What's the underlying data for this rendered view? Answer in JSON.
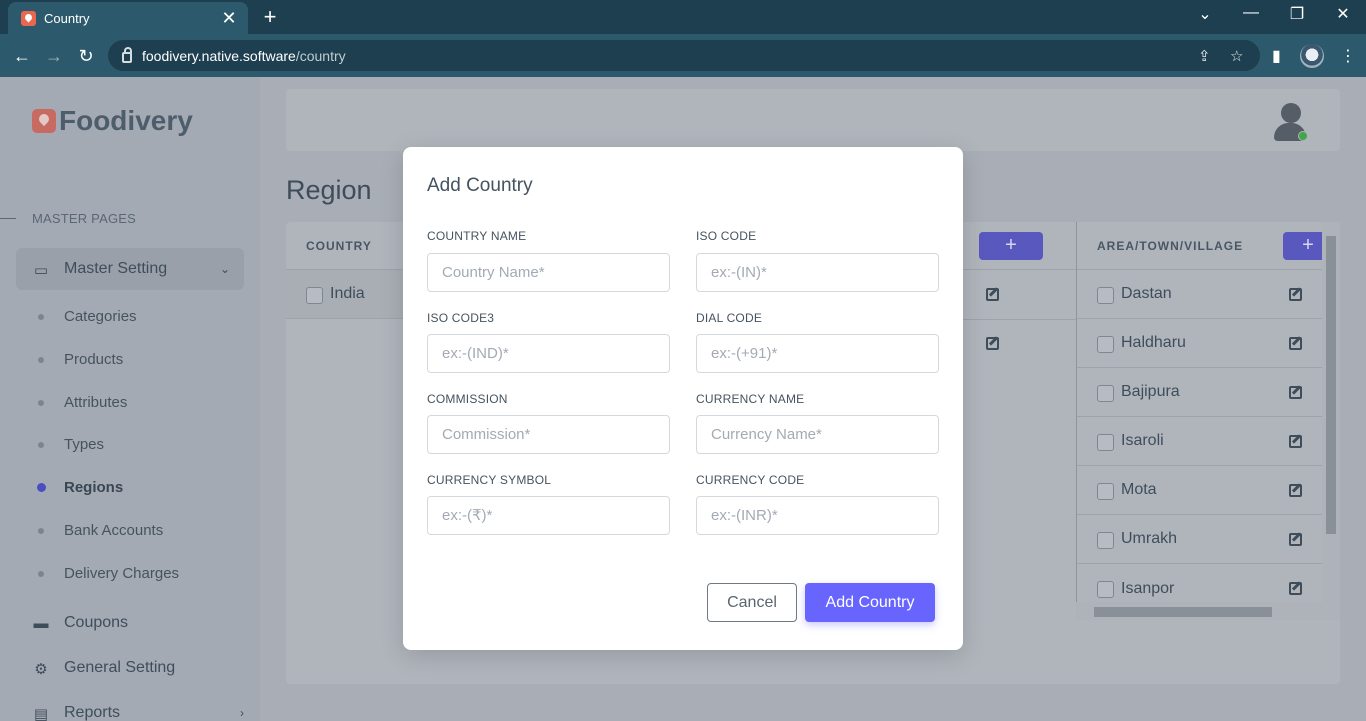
{
  "browser": {
    "tab_title": "Country",
    "tab_close": "✕",
    "new_tab": "+",
    "url_host": "foodivery.native.software",
    "url_path": "/country",
    "window_controls": {
      "dropdown": "⌄",
      "minimize": "—",
      "restore": "❐",
      "close": "✕"
    },
    "nav": {
      "back": "←",
      "forward": "→",
      "reload": "↻"
    },
    "icons": {
      "share": "⇪",
      "bookmark": "☆",
      "sidebar": "▮",
      "menu": "⋮"
    }
  },
  "sidebar": {
    "logo": "Foodivery",
    "section_label": "MASTER PAGES",
    "master_setting": {
      "label": "Master Setting",
      "icon": "▭",
      "chevron": "⌄"
    },
    "sub_items": [
      {
        "label": "Categories"
      },
      {
        "label": "Products"
      },
      {
        "label": "Attributes"
      },
      {
        "label": "Types"
      },
      {
        "label": "Regions"
      },
      {
        "label": "Bank Accounts"
      },
      {
        "label": "Delivery Charges"
      }
    ],
    "menu_items": [
      {
        "label": "Coupons",
        "icon": "▬"
      },
      {
        "label": "General Setting",
        "icon": "⚙"
      },
      {
        "label": "Reports",
        "icon": "▤",
        "chevron": "›"
      }
    ]
  },
  "main": {
    "page_title": "Region",
    "country_col": {
      "header": "COUNTRY",
      "rows": [
        "India"
      ]
    },
    "add_button": "+",
    "area_col": {
      "header": "AREA/TOWN/VILLAGE",
      "rows": [
        "Dastan",
        "Haldharu",
        "Bajipura",
        "Isaroli",
        "Mota",
        "Umrakh",
        "Isanpor"
      ]
    }
  },
  "modal": {
    "title": "Add Country",
    "fields": {
      "country_name": {
        "label": "COUNTRY NAME",
        "placeholder": "Country Name*"
      },
      "iso_code": {
        "label": "ISO CODE",
        "placeholder": "ex:-(IN)*"
      },
      "iso_code3": {
        "label": "ISO CODE3",
        "placeholder": "ex:-(IND)*"
      },
      "dial_code": {
        "label": "DIAL CODE",
        "placeholder": "ex:-(+91)*"
      },
      "commission": {
        "label": "COMMISSION",
        "placeholder": "Commission*"
      },
      "currency_name": {
        "label": "CURRENCY NAME",
        "placeholder": "Currency Name*"
      },
      "currency_symbol": {
        "label": "CURRENCY SYMBOL",
        "placeholder": "ex:-(₹)*"
      },
      "currency_code": {
        "label": "CURRENCY CODE",
        "placeholder": "ex:-(INR)*"
      }
    },
    "cancel_label": "Cancel",
    "submit_label": "Add Country"
  },
  "colors": {
    "accent": "#6865ff",
    "chrome": "#2c5a6c",
    "tabbar": "#1d3f4f"
  }
}
